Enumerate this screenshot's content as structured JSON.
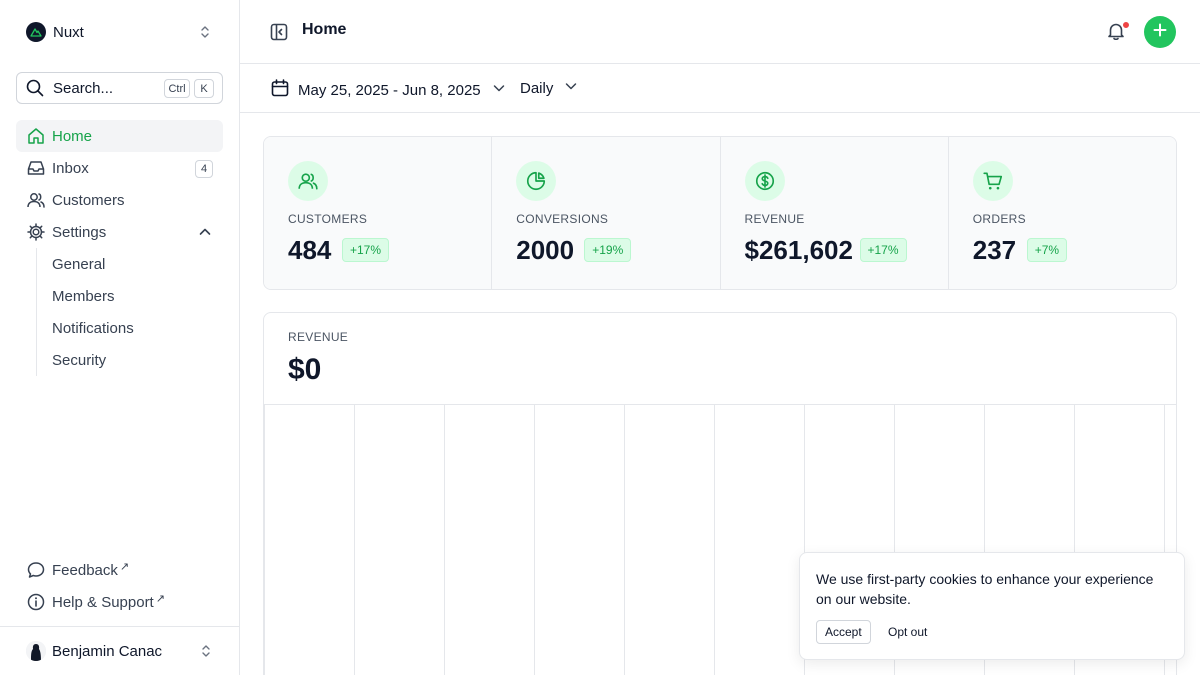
{
  "colors": {
    "accent": "#22c55e",
    "accent_text": "#16a34a",
    "notification_dot": "#ef4444"
  },
  "sidebar": {
    "team_name": "Nuxt",
    "search": {
      "label": "Search...",
      "shortcut_ctrl": "Ctrl",
      "shortcut_key": "K"
    },
    "items": [
      {
        "label": "Home",
        "icon": "home-icon",
        "active": true
      },
      {
        "label": "Inbox",
        "icon": "inbox-icon",
        "badge": "4"
      },
      {
        "label": "Customers",
        "icon": "users-icon"
      },
      {
        "label": "Settings",
        "icon": "gear-icon",
        "expanded": true
      }
    ],
    "settings_children": [
      "General",
      "Members",
      "Notifications",
      "Security"
    ],
    "footer_links": [
      {
        "label": "Feedback",
        "icon": "message-icon",
        "external": "↗"
      },
      {
        "label": "Help & Support",
        "icon": "info-icon",
        "external": "↗"
      }
    ],
    "user_name": "Benjamin Canac"
  },
  "header": {
    "title": "Home"
  },
  "toolbar": {
    "date_range": "May 25, 2025 - Jun 8, 2025",
    "period": "Daily"
  },
  "stats": [
    {
      "name": "Customers",
      "value": "484",
      "delta": "+17%",
      "icon": "users-icon"
    },
    {
      "name": "Conversions",
      "value": "2000",
      "delta": "+19%",
      "icon": "pie-chart-icon"
    },
    {
      "name": "Revenue",
      "value": "$261,602",
      "delta": "+17%",
      "icon": "dollar-circle-icon"
    },
    {
      "name": "Orders",
      "value": "237",
      "delta": "+7%",
      "icon": "cart-icon"
    }
  ],
  "revenue_card": {
    "name": "Revenue",
    "value": "$0"
  },
  "cookie": {
    "message": "We use first-party cookies to enhance your experience on our website.",
    "accept_label": "Accept",
    "opt_out_label": "Opt out"
  }
}
